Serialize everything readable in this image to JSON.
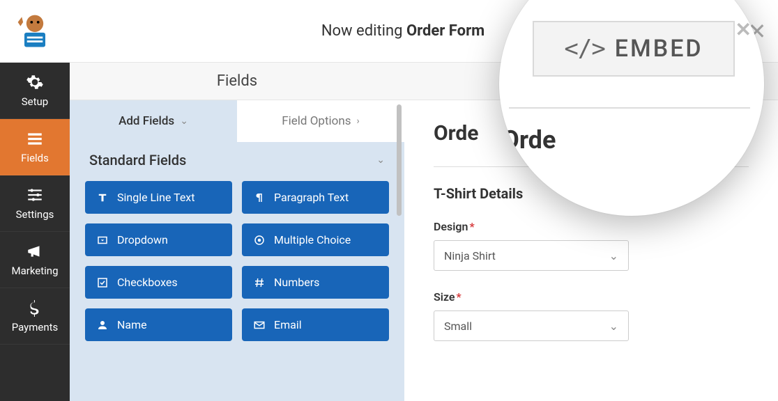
{
  "header": {
    "now_editing_prefix": "Now editing ",
    "form_name": "Order Form"
  },
  "sidebar": {
    "items": [
      {
        "label": "Setup"
      },
      {
        "label": "Fields"
      },
      {
        "label": "Settings"
      },
      {
        "label": "Marketing"
      },
      {
        "label": "Payments"
      }
    ]
  },
  "center": {
    "tab_label": "Fields",
    "tabs": {
      "add": "Add Fields",
      "options": "Field Options"
    },
    "section_heading": "Standard Fields",
    "field_buttons": [
      {
        "label": "Single Line Text",
        "icon": "text"
      },
      {
        "label": "Paragraph Text",
        "icon": "paragraph"
      },
      {
        "label": "Dropdown",
        "icon": "dropdown"
      },
      {
        "label": "Multiple Choice",
        "icon": "radio"
      },
      {
        "label": "Checkboxes",
        "icon": "check"
      },
      {
        "label": "Numbers",
        "icon": "hash"
      },
      {
        "label": "Name",
        "icon": "user"
      },
      {
        "label": "Email",
        "icon": "mail"
      }
    ]
  },
  "preview": {
    "form_title_partial": "Orde",
    "section_title": "T-Shirt Details",
    "fields": {
      "design": {
        "label": "Design",
        "value": "Ninja Shirt"
      },
      "size": {
        "label": "Size",
        "value": "Small"
      }
    }
  },
  "lens": {
    "embed_label": "EMBED",
    "order_partial": "Orde"
  }
}
